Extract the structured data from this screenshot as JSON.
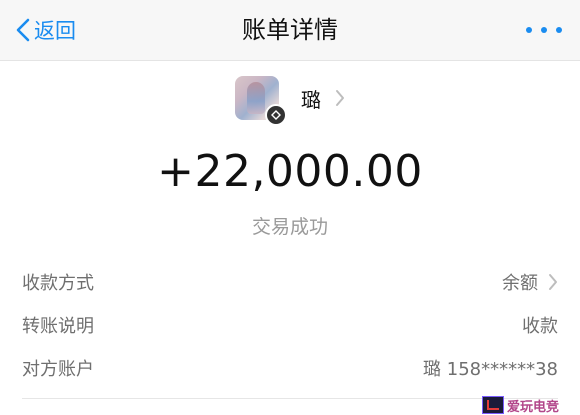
{
  "nav": {
    "back_label": "返回",
    "title": "账单详情"
  },
  "payee": {
    "name": "璐"
  },
  "transaction": {
    "amount": "+22,000.00",
    "status": "交易成功"
  },
  "details": [
    {
      "label": "收款方式",
      "value": "余额"
    },
    {
      "label": "转账说明",
      "value": "收款"
    },
    {
      "label": "对方账户",
      "value": "璐 158******38"
    }
  ],
  "watermark": {
    "text": "爱玩电竞"
  },
  "colors": {
    "accent": "#1a8cf0",
    "muted_text": "#6f6f6f",
    "status_text": "#9a9a9a"
  }
}
